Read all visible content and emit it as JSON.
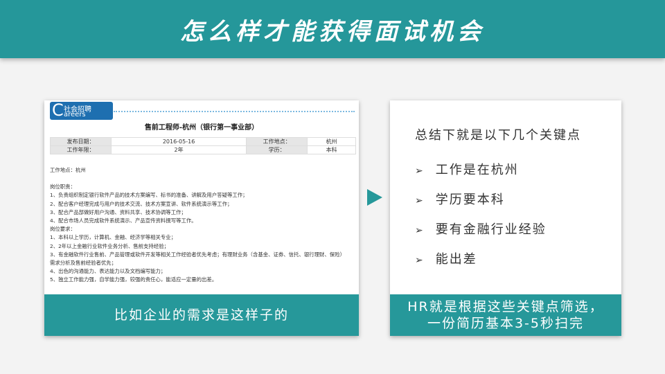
{
  "title": "怎么样才能获得面试机会",
  "left": {
    "logo": {
      "c": "C",
      "zh": "社会招聘",
      "en": "areers"
    },
    "job_title": "售前工程师-杭州（银行第一事业部）",
    "table": [
      [
        "发布日期：",
        "2016-05-16",
        "工作地点：",
        "杭州"
      ],
      [
        "工作年限：",
        "2年",
        "学历：",
        "本科"
      ]
    ],
    "lines": [
      "工作地点：杭州",
      "",
      "岗位职责：",
      "1、负责组织制定银行软件产品的技术方案编写、标书的准备、讲解及用户答疑等工作；",
      "2、配合客户经理完成与用户的技术交流、技术方案宣讲、软件系统演示等工作；",
      "3、配合产品部做好用户沟通、资料共享、技术协调等工作；",
      "4、配合市场人员完成软件系统演示、产品宣传资料撰写等工作。",
      "岗位要求：",
      "1、本科以上学历，计算机、金融、经济学等相关专业；",
      "2、2年以上金融行业软件业务分析、售前支持经验；",
      "3、有金融软件行业售前、产品管理或软件开发等相关工作经验者优先考虑；有理财业务（含基金、证券、信托、银行理财、保险）",
      "需求分析及售前经验者优先；",
      "4、出色的沟通能力、表达能力以及文档编写能力；",
      "5、独立工作能力强，自学能力强，较强的责任心，能适应一定量的出差。"
    ],
    "caption": "比如企业的需求是这样子的"
  },
  "right": {
    "summary": "总结下就是以下几个关键点",
    "bullet": "➢",
    "points": [
      "工作是在杭州",
      "学历要本科",
      "要有金融行业经验",
      "能出差"
    ],
    "caption_1": "HR就是根据这些关键点筛选，",
    "caption_2": "一份简历基本3-5秒扫完"
  }
}
